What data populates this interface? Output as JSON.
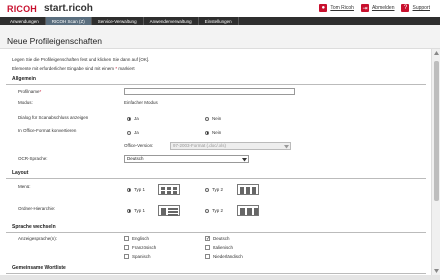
{
  "brand": {
    "logo": "RICOH",
    "app": "start.ricoh"
  },
  "header": {
    "user": "Tom Ricoh",
    "logout": "Abmelden",
    "support": "Support"
  },
  "nav": {
    "tabs": [
      "Anwendungen",
      "RICOH Scan (Z)",
      "Service-Verwaltung",
      "Anwenderverwaltung",
      "Einstellungen"
    ],
    "active_index": 1
  },
  "page": {
    "title": "Neue Profileigenschaften",
    "intro1": "Legen Sie die Profileigenschaften fest und klicken Sie dann auf [OK].",
    "intro2_prefix": "Elemente mit erforderlicher Eingabe sind mit einem",
    "intro2_mark": "*",
    "intro2_suffix": "markiert"
  },
  "general": {
    "title": "Allgemein",
    "profile_name_label": "Profilname",
    "profile_name_value": "",
    "mode_label": "Modus:",
    "mode_value": "Einfacher Modus",
    "scan_end_label": "Dialog für Scanabschluss anzeigen",
    "office_label": "In Office-Format konvertieren",
    "office_version_label": "Office-Version:",
    "office_version_value": "97-2003-Format (.doc/.xls)",
    "ocr_label": "OCR-Sprache:",
    "ocr_value": "Deutsch",
    "yes": "Ja",
    "no": "Nein"
  },
  "layout": {
    "title": "Layout",
    "menu_label": "Menü:",
    "folder_label": "Ordner-Hierarchie:",
    "type1": "Typ 1",
    "type2": "Typ 2"
  },
  "language": {
    "title": "Sprache wechseln",
    "display_label": "Anzeigesprache(n):",
    "options": [
      "Englisch",
      "Französisch",
      "Spanisch",
      "Deutsch",
      "Italienisch",
      "Niederländisch"
    ],
    "checked": [
      false,
      false,
      false,
      true,
      false,
      false
    ]
  },
  "wordlist": {
    "title": "Gemeinsame Wortliste"
  },
  "colors": {
    "brand_red": "#c8102e",
    "nav_bg": "#2e2e2e",
    "nav_active": "#5a6e7e"
  }
}
